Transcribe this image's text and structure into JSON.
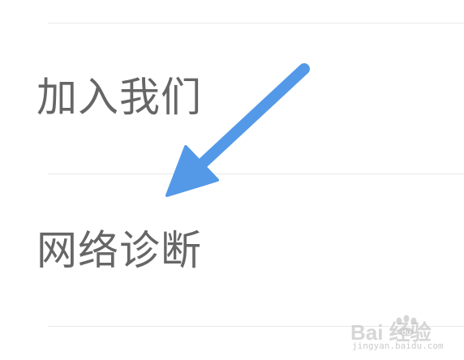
{
  "menu": {
    "items": [
      {
        "label": "加入我们"
      },
      {
        "label": "网络诊断"
      }
    ]
  },
  "annotation": {
    "arrow_color": "#5399e8",
    "arrow_icon": "arrow-down-left-icon"
  },
  "colors": {
    "background": "#ffffff",
    "text": "#666666",
    "divider": "#e9e9e9"
  },
  "watermark": {
    "brand": "Bai  经验",
    "site": "jingyan.baidu.com"
  }
}
